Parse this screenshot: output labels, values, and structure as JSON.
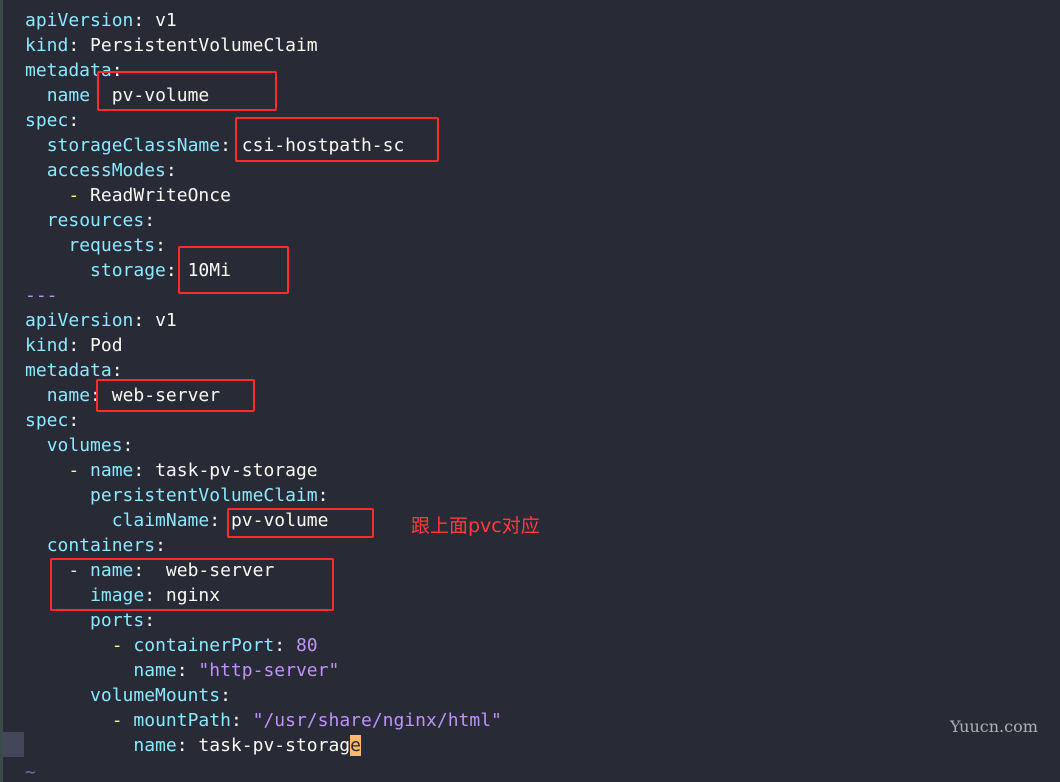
{
  "lines": [
    {
      "indent": "",
      "dash": "",
      "key": "apiVersion",
      "colon": ": ",
      "value": "v1",
      "vclass": "v"
    },
    {
      "indent": "",
      "dash": "",
      "key": "kind",
      "colon": ": ",
      "value": "PersistentVolumeClaim",
      "vclass": "v"
    },
    {
      "indent": "",
      "dash": "",
      "key": "metadata",
      "colon": ":",
      "value": "",
      "vclass": "v"
    },
    {
      "indent": "  ",
      "dash": "",
      "key": "name",
      "colon": "  ",
      "value": "pv-volume",
      "vclass": "v"
    },
    {
      "indent": "",
      "dash": "",
      "key": "spec",
      "colon": ":",
      "value": "",
      "vclass": "v"
    },
    {
      "indent": "  ",
      "dash": "",
      "key": "storageClassName",
      "colon": ": ",
      "value": "csi-hostpath-sc",
      "vclass": "v"
    },
    {
      "indent": "  ",
      "dash": "",
      "key": "accessModes",
      "colon": ":",
      "value": "",
      "vclass": "v"
    },
    {
      "indent": "    ",
      "dash": "- ",
      "key": "",
      "colon": "",
      "value": "ReadWriteOnce",
      "vclass": "v"
    },
    {
      "indent": "  ",
      "dash": "",
      "key": "resources",
      "colon": ":",
      "value": "",
      "vclass": "v"
    },
    {
      "indent": "    ",
      "dash": "",
      "key": "requests",
      "colon": ":",
      "value": "",
      "vclass": "v"
    },
    {
      "indent": "      ",
      "dash": "",
      "key": "storage",
      "colon": ": ",
      "value": "10Mi",
      "vclass": "v"
    },
    {
      "indent": "",
      "dash": "",
      "key": "",
      "colon": "",
      "value": "---",
      "vclass": "s"
    },
    {
      "indent": "",
      "dash": "",
      "key": "apiVersion",
      "colon": ": ",
      "value": "v1",
      "vclass": "v"
    },
    {
      "indent": "",
      "dash": "",
      "key": "kind",
      "colon": ": ",
      "value": "Pod",
      "vclass": "v"
    },
    {
      "indent": "",
      "dash": "",
      "key": "metadata",
      "colon": ":",
      "value": "",
      "vclass": "v"
    },
    {
      "indent": "  ",
      "dash": "",
      "key": "name",
      "colon": ": ",
      "value": "web-server",
      "vclass": "v"
    },
    {
      "indent": "",
      "dash": "",
      "key": "spec",
      "colon": ":",
      "value": "",
      "vclass": "v"
    },
    {
      "indent": "  ",
      "dash": "",
      "key": "volumes",
      "colon": ":",
      "value": "",
      "vclass": "v"
    },
    {
      "indent": "    ",
      "dash": "- ",
      "key": "name",
      "colon": ": ",
      "value": "task-pv-storage",
      "vclass": "v"
    },
    {
      "indent": "      ",
      "dash": "",
      "key": "persistentVolumeClaim",
      "colon": ":",
      "value": "",
      "vclass": "v"
    },
    {
      "indent": "        ",
      "dash": "",
      "key": "claimName",
      "colon": ": ",
      "value": "pv-volume",
      "vclass": "v"
    },
    {
      "indent": "  ",
      "dash": "",
      "key": "containers",
      "colon": ":",
      "value": "",
      "vclass": "v"
    },
    {
      "indent": "    ",
      "dash": "- ",
      "key": "name",
      "colon": ":  ",
      "value": "web-server",
      "vclass": "v"
    },
    {
      "indent": "      ",
      "dash": "",
      "key": "image",
      "colon": ": ",
      "value": "nginx",
      "vclass": "v"
    },
    {
      "indent": "      ",
      "dash": "",
      "key": "ports",
      "colon": ":",
      "value": "",
      "vclass": "v"
    },
    {
      "indent": "        ",
      "dash": "- ",
      "key": "containerPort",
      "colon": ": ",
      "value": "80",
      "vclass": "n"
    },
    {
      "indent": "          ",
      "dash": "",
      "key": "name",
      "colon": ": ",
      "value": "\"http-server\"",
      "vclass": "s"
    },
    {
      "indent": "      ",
      "dash": "",
      "key": "volumeMounts",
      "colon": ":",
      "value": "",
      "vclass": "v"
    },
    {
      "indent": "        ",
      "dash": "- ",
      "key": "mountPath",
      "colon": ": ",
      "value": "\"/usr/share/nginx/html\"",
      "vclass": "s"
    },
    {
      "indent": "          ",
      "dash": "",
      "key": "name",
      "colon": ": ",
      "value": "task-pv-storag",
      "vclass": "v",
      "cursor": "e"
    }
  ],
  "tilde": "~",
  "annotation": "跟上面pvc对应",
  "watermark": "Yuucn.com",
  "colors": {
    "background": "#282a36",
    "key": "#8be9fd",
    "string": "#bd93f9",
    "dash": "#f1fa8c",
    "highlight_box": "#ff2a2a",
    "cursor": "#ffb86c"
  }
}
